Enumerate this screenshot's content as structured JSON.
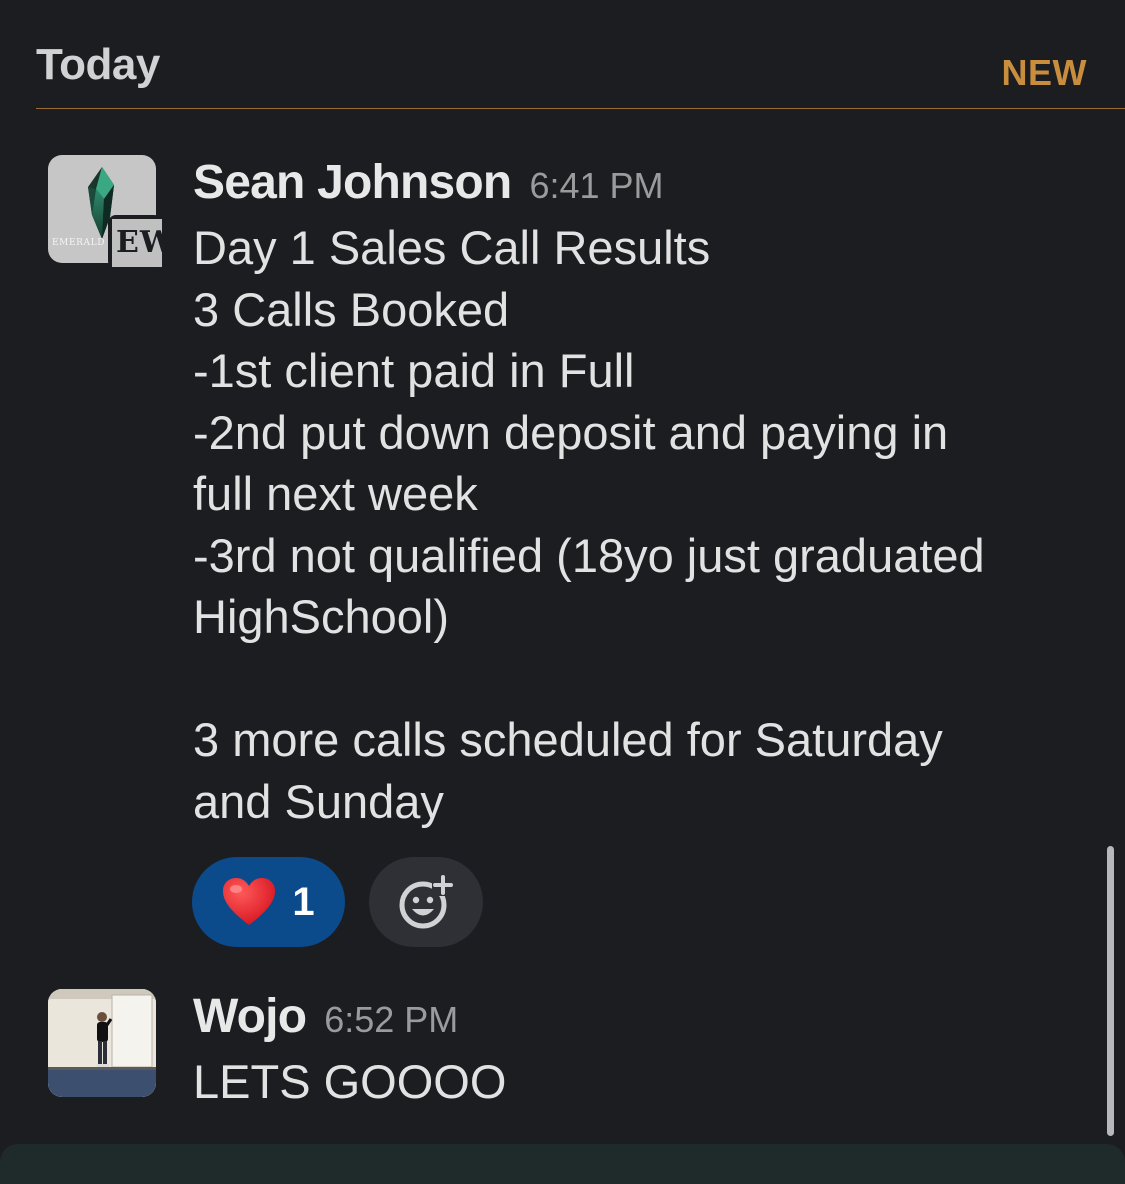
{
  "day_header": {
    "title": "Today",
    "new_label": "NEW"
  },
  "messages": [
    {
      "author": "Sean Johnson",
      "time": "6:41 PM",
      "avatar": {
        "icon": "emerald-crystal-icon",
        "badge_text": "EW",
        "logo_word": "EMERALD"
      },
      "text": "Day 1 Sales Call Results\n3 Calls Booked\n-1st client paid in Full\n-2nd put down deposit and paying in\nfull next week\n-3rd not qualified (18yo just graduated\nHighSchool)\n\n3 more calls scheduled for Saturday\nand Sunday",
      "reactions": [
        {
          "emoji_icon": "heart-icon",
          "emoji": "❤️",
          "count": "1"
        }
      ],
      "add_reaction_icon": "add-emoji-icon"
    },
    {
      "author": "Wojo",
      "time": "6:52 PM",
      "avatar": {
        "icon": "speaker-photo-icon"
      },
      "text": "LETS GOOOO"
    }
  ],
  "colors": {
    "background": "#1b1d21",
    "new_accent": "#c98d3e",
    "reaction_bg": "#0b4b8c"
  }
}
